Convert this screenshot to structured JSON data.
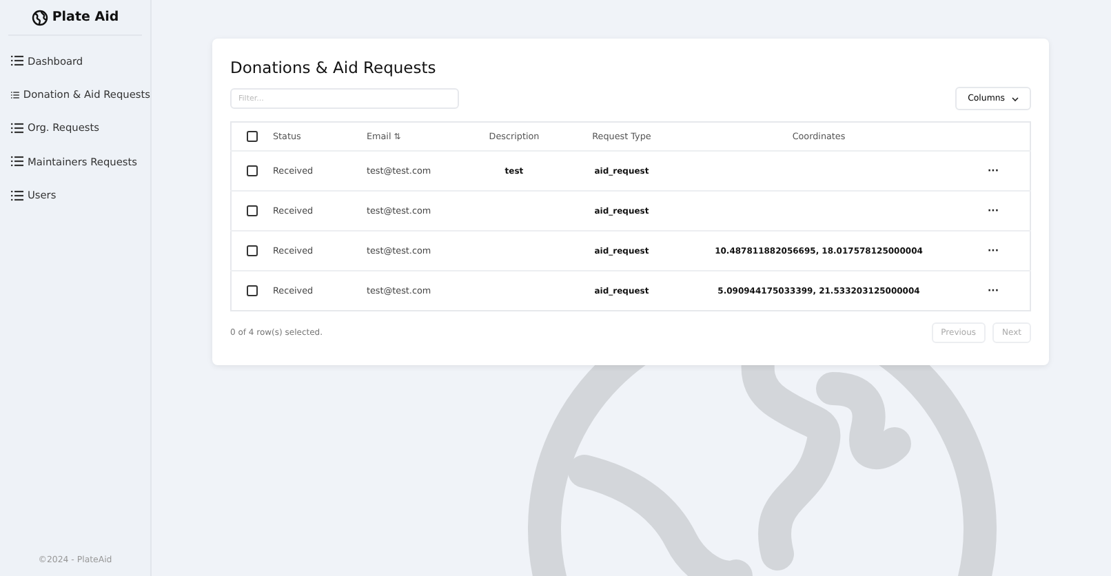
{
  "sidebar": {
    "logo": "Plate Aid",
    "items": [
      {
        "label": "Dashboard",
        "selected": false
      },
      {
        "label": "Donation & Aid Requests",
        "selected": false
      },
      {
        "label": "Org. Requests",
        "selected": false
      },
      {
        "label": "Maintainers Requests",
        "selected": false
      },
      {
        "label": "Users",
        "selected": false
      }
    ],
    "footer": "©2024 - PlateAid"
  },
  "card": {
    "title": "Donations & Aid Requests",
    "filter": {
      "placeholder": "Filter..."
    },
    "columns_button": "Columns",
    "table": {
      "select_all": {
        "checked": false
      },
      "columns": [
        "Status",
        "Email",
        "Description",
        "Request Type",
        "Coordinates"
      ],
      "sort_icon": "⇅",
      "rows": [
        {
          "checked": false,
          "status": "Received",
          "email": "test@test.com",
          "description": "test",
          "request_type": "aid_request",
          "coordinates": "",
          "actions": "···"
        },
        {
          "checked": false,
          "status": "Received",
          "email": "test@test.com",
          "description": "",
          "request_type": "aid_request",
          "coordinates": "",
          "actions": "···"
        },
        {
          "checked": false,
          "status": "Received",
          "email": "test@test.com",
          "description": "",
          "request_type": "aid_request",
          "coordinates": "10.487811882056695, 18.017578125000004",
          "actions": "···"
        },
        {
          "checked": false,
          "status": "Received",
          "email": "test@test.com",
          "description": "",
          "request_type": "aid_request",
          "coordinates": "5.090944175033399, 21.533203125000004",
          "actions": "···"
        }
      ]
    },
    "selection_summary": "0 of 4 row(s) selected.",
    "pagination": [
      {
        "label": "Previous",
        "disabled": true
      },
      {
        "label": "Next",
        "disabled": true
      }
    ]
  }
}
